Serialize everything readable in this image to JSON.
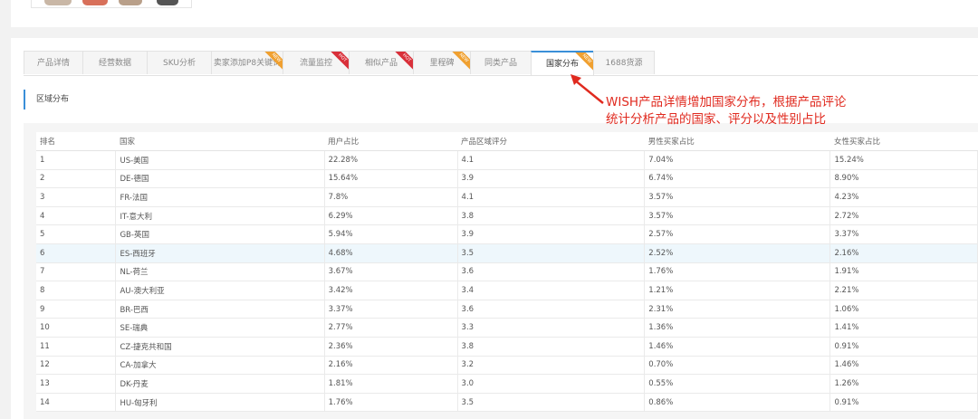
{
  "tabs": [
    {
      "label": "产品详情",
      "badge": "",
      "badge_color": ""
    },
    {
      "label": "经营数据",
      "badge": "",
      "badge_color": ""
    },
    {
      "label": "SKU分析",
      "badge": "",
      "badge_color": ""
    },
    {
      "label": "卖家添加P8关键词",
      "badge": "NEW",
      "badge_color": "#f0a030"
    },
    {
      "label": "流量监控",
      "badge": "HOT",
      "badge_color": "#d9303a"
    },
    {
      "label": "相似产品",
      "badge": "HOT",
      "badge_color": "#d9303a"
    },
    {
      "label": "里程碑",
      "badge": "NEW",
      "badge_color": "#f0a030"
    },
    {
      "label": "同类产品",
      "badge": "",
      "badge_color": ""
    },
    {
      "label": "国家分布",
      "badge": "NEW",
      "badge_color": "#f0a030",
      "active": true
    },
    {
      "label": "1688货源",
      "badge": "",
      "badge_color": ""
    }
  ],
  "section_title": "区域分布",
  "annotation": {
    "line1": "WISH产品详情增加国家分布，根据产品评论",
    "line2": "统计分析产品的国家、评分以及性别占比",
    "color": "#e02a1f"
  },
  "table": {
    "headers": [
      "排名",
      "国家",
      "用户占比",
      "产品区域评分",
      "男性买家占比",
      "女性买家占比"
    ],
    "rows": [
      [
        "1",
        "US-美国",
        "22.28%",
        "4.1",
        "7.04%",
        "15.24%"
      ],
      [
        "2",
        "DE-德国",
        "15.64%",
        "3.9",
        "6.74%",
        "8.90%"
      ],
      [
        "3",
        "FR-法国",
        "7.8%",
        "4.1",
        "3.57%",
        "4.23%"
      ],
      [
        "4",
        "IT-意大利",
        "6.29%",
        "3.8",
        "3.57%",
        "2.72%"
      ],
      [
        "5",
        "GB-英国",
        "5.94%",
        "3.9",
        "2.57%",
        "3.37%"
      ],
      [
        "6",
        "ES-西班牙",
        "4.68%",
        "3.5",
        "2.52%",
        "2.16%"
      ],
      [
        "7",
        "NL-荷兰",
        "3.67%",
        "3.6",
        "1.76%",
        "1.91%"
      ],
      [
        "8",
        "AU-澳大利亚",
        "3.42%",
        "3.4",
        "1.21%",
        "2.21%"
      ],
      [
        "9",
        "BR-巴西",
        "3.37%",
        "3.6",
        "2.31%",
        "1.06%"
      ],
      [
        "10",
        "SE-瑞典",
        "2.77%",
        "3.3",
        "1.36%",
        "1.41%"
      ],
      [
        "11",
        "CZ-捷克共和国",
        "2.36%",
        "3.8",
        "1.46%",
        "0.91%"
      ],
      [
        "12",
        "CA-加拿大",
        "2.16%",
        "3.2",
        "0.70%",
        "1.46%"
      ],
      [
        "13",
        "DK-丹麦",
        "1.81%",
        "3.0",
        "0.55%",
        "1.26%"
      ],
      [
        "14",
        "HU-匈牙利",
        "1.76%",
        "3.5",
        "0.86%",
        "0.91%"
      ]
    ],
    "highlight_row_index": 5
  },
  "colors": {
    "accent": "#3a8fd8",
    "highlight_row": "#eef7fc"
  }
}
